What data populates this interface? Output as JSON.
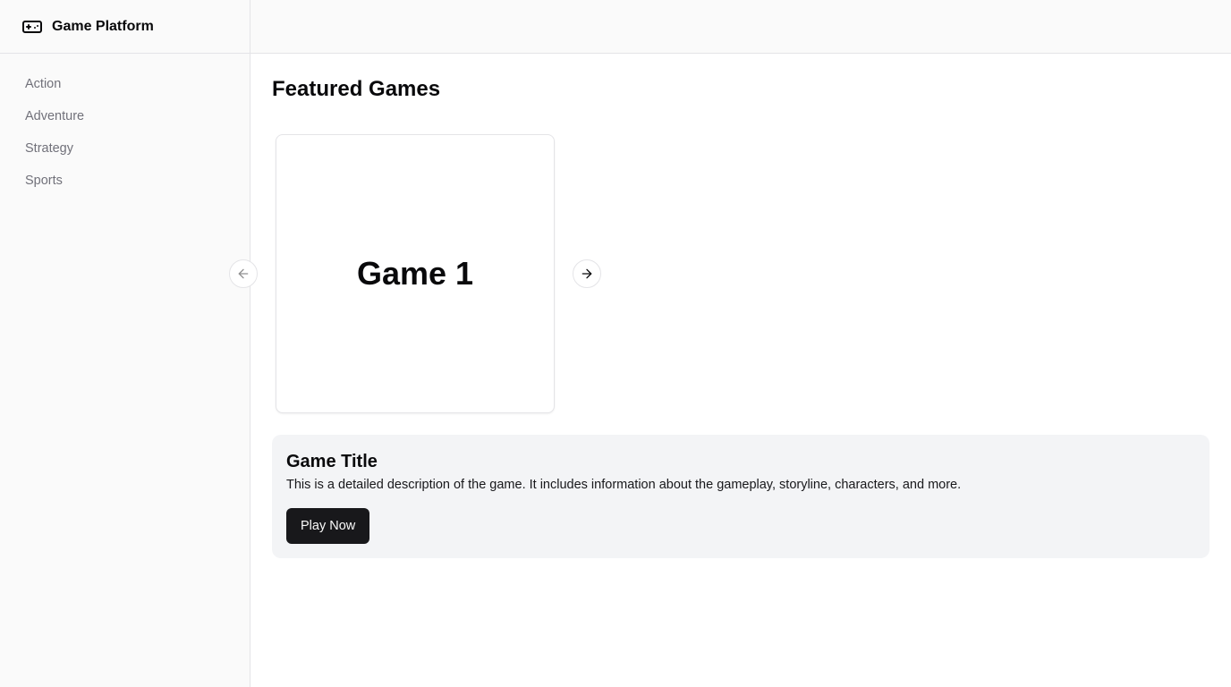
{
  "app": {
    "title": "Game Platform",
    "icon": "gamepad-icon"
  },
  "sidebar": {
    "items": [
      {
        "label": "Action"
      },
      {
        "label": "Adventure"
      },
      {
        "label": "Strategy"
      },
      {
        "label": "Sports"
      }
    ]
  },
  "main": {
    "section_title": "Featured Games",
    "carousel": {
      "current_card": "Game 1",
      "prev_icon": "arrow-left-icon",
      "next_icon": "arrow-right-icon"
    },
    "details": {
      "title": "Game Title",
      "description": "This is a detailed description of the game. It includes information about the gameplay, storyline, characters, and more.",
      "play_label": "Play Now"
    }
  },
  "colors": {
    "primary_button": "#18181b",
    "details_background": "#f3f4f6",
    "muted_text": "#71717a"
  }
}
